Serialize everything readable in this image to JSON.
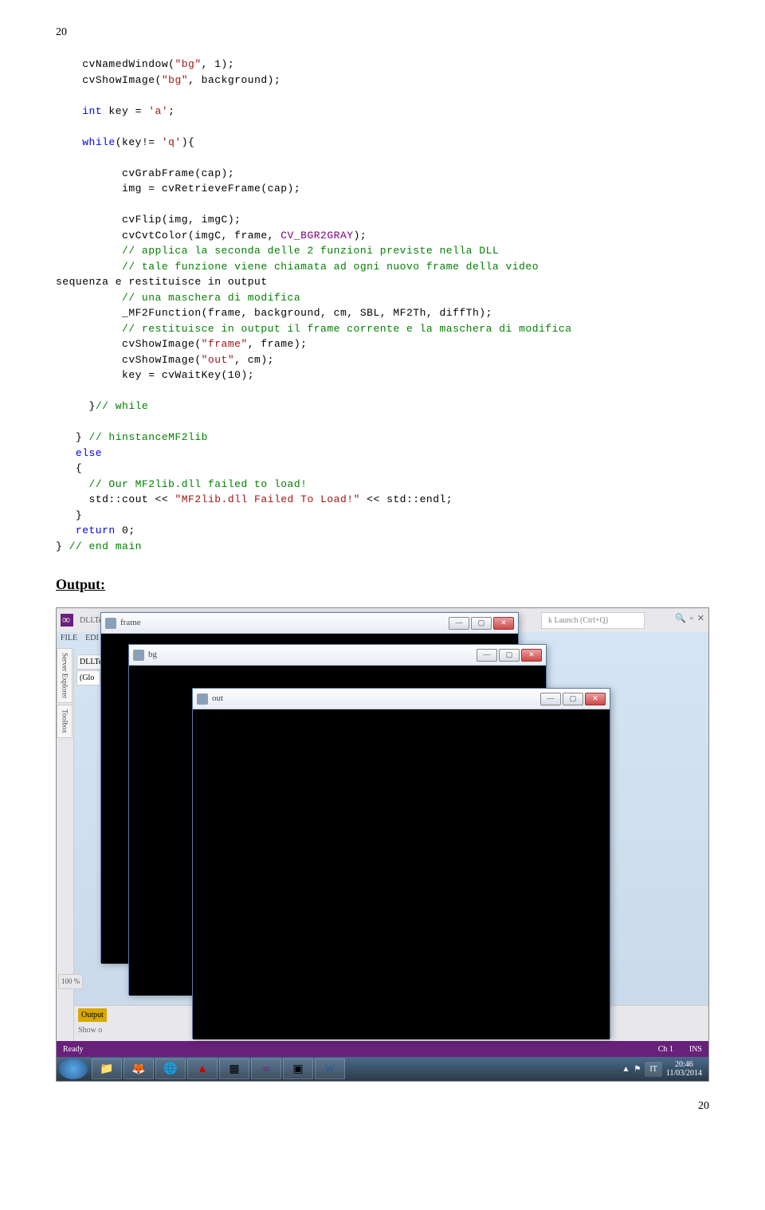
{
  "page_num_top": "20",
  "code": {
    "l1a": "cvNamedWindow(",
    "l1b": "\"bg\"",
    "l1c": ", 1);",
    "l2a": "cvShowImage(",
    "l2b": "\"bg\"",
    "l2c": ", background);",
    "l3a": "int",
    "l3b": " key = ",
    "l3c": "'a'",
    "l3d": ";",
    "l4a": "while",
    "l4b": "(key!= ",
    "l4c": "'q'",
    "l4d": "){",
    "l5": "cvGrabFrame(cap);",
    "l6": "img = cvRetrieveFrame(cap);",
    "l7": "cvFlip(img, imgC);",
    "l8a": "cvCvtColor(imgC, frame, ",
    "l8b": "CV_BGR2GRAY",
    "l8c": ");",
    "l9": "// applica la seconda delle 2 funzioni previste nella DLL",
    "l10": "// tale funzione viene chiamata ad ogni nuovo frame della video",
    "l11": "sequenza e restituisce in output",
    "l12": "// una maschera di modifica",
    "l13": "_MF2Function(frame, background, cm, SBL, MF2Th, diffTh);",
    "l14": "// restituisce in output il frame corrente e la maschera di modifica",
    "l15a": "cvShowImage(",
    "l15b": "\"frame\"",
    "l15c": ", frame);",
    "l16a": "cvShowImage(",
    "l16b": "\"out\"",
    "l16c": ", cm);",
    "l17": "key = cvWaitKey(10);",
    "l18a": "}",
    "l18b": "// while",
    "l19a": "} ",
    "l19b": "// hinstanceMF2lib",
    "l20": "else",
    "l21": "{",
    "l22": "// Our MF2lib.dll failed to load!",
    "l23a": "std::cout << ",
    "l23b": "\"MF2lib.dll Failed To Load!\"",
    "l23c": " << std::endl;",
    "l24": "}",
    "l25a": "return",
    "l25b": " 0;",
    "l26a": "} ",
    "l26b": "// end main"
  },
  "output_heading": "Output:",
  "vs": {
    "tab_name": "DLLTe",
    "menu": {
      "file": "FILE",
      "edit": "EDI"
    },
    "left_tabs": [
      "Server Explorer",
      "Toolbox"
    ],
    "quick_launch": "k Launch (Ctrl+Q)",
    "search_icon": "🔍",
    "bottom_label1": "Output",
    "bottom_label2": "Show o",
    "pct": "100 %",
    "status_left": "Ready",
    "status_ch": "Ch 1",
    "status_ins": "INS",
    "left_dropdown": "(Glo"
  },
  "windows": {
    "frame": {
      "title": "frame"
    },
    "bg": {
      "title": "bg"
    },
    "out": {
      "title": "out"
    }
  },
  "taskbar": {
    "tray_lang": "IT",
    "tray_time": "20:46",
    "tray_date": "11/03/2014"
  },
  "page_num_bottom": "20"
}
